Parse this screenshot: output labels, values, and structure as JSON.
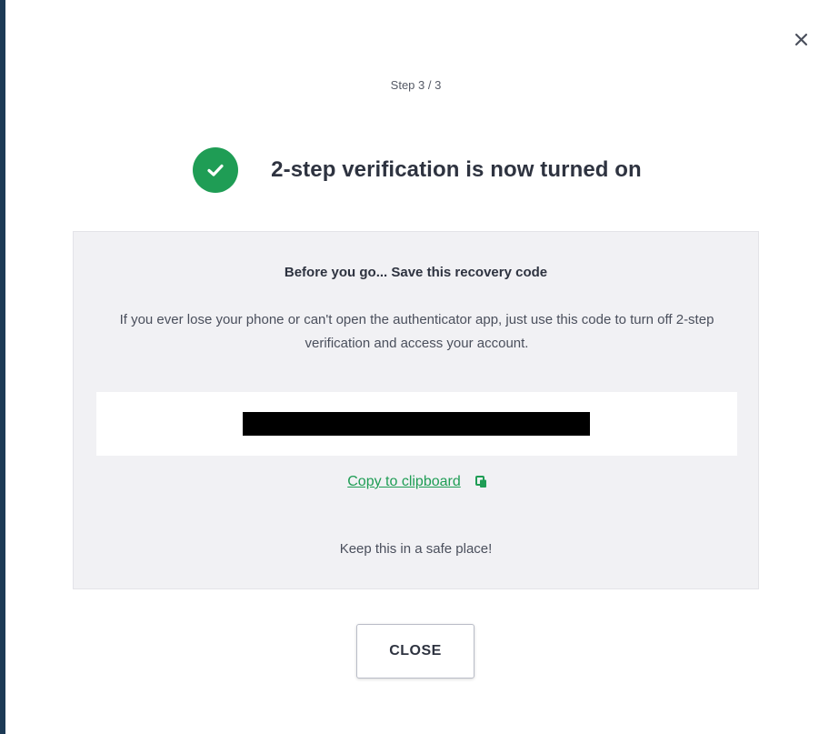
{
  "dialog": {
    "step_text": "Step 3 / 3",
    "title": "2-step verification is now turned on",
    "close_icon": "close-icon",
    "status_icon": "check-circle-icon",
    "colors": {
      "accent_green": "#1f9d55",
      "panel_background": "#f1f1f4",
      "left_edge": "#1c3a55"
    }
  },
  "recovery": {
    "title": "Before you go... Save this recovery code",
    "description": "If you ever lose your phone or can't open the authenticator app, just use this code to turn off 2-step verification and access your account.",
    "code_redacted": true,
    "copy_label": "Copy to clipboard",
    "copy_icon": "copy-icon",
    "footer_note": "Keep this in a safe place!"
  },
  "actions": {
    "close_label": "CLOSE"
  }
}
